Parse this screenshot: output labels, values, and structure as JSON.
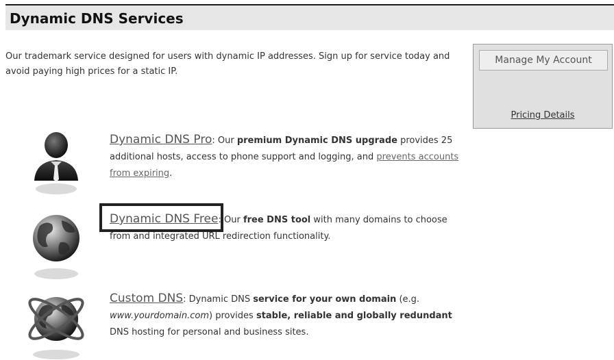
{
  "header": {
    "title": "Dynamic DNS Services"
  },
  "intro": {
    "text": "Our trademark service designed for users with dynamic IP addresses. Sign up for service today and avoid paying high prices for a static IP."
  },
  "sidebox": {
    "manage_button": "Manage My Account",
    "pricing_link": "Pricing Details"
  },
  "services": [
    {
      "icon": "user-person-icon",
      "link": "Dynamic DNS Pro",
      "sep": ": Our ",
      "bold1": "premium Dynamic DNS upgrade",
      "text1": " provides 25 additional hosts, access to phone support and logging, and ",
      "link2": "prevents accounts from expiring",
      "text2": "."
    },
    {
      "icon": "globe-icon",
      "link": "Dynamic DNS Free",
      "sep": ": Our ",
      "bold1": "free DNS tool",
      "text1": " with many domains to choose from and integrated URL redirection functionality."
    },
    {
      "icon": "globe-orbit-icon",
      "link": "Custom DNS",
      "sep": ": Dynamic DNS ",
      "bold1": "service for your own domain",
      "text1": " (e.g. ",
      "italic1": "www.yourdomain.com",
      "text2": ") provides ",
      "bold2": "stable, reliable and globally redundant",
      "text3": " DNS hosting for personal and business sites."
    }
  ],
  "colors": {
    "header_bg": "#e6e6e6",
    "sidebox_bg": "#e0e0e0",
    "highlight_border": "#222222"
  }
}
